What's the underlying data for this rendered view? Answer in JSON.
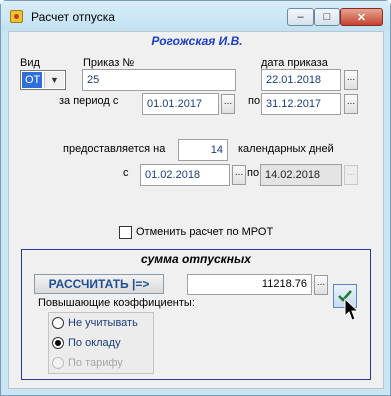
{
  "window": {
    "title": "Расчет отпуска",
    "minimize_glyph": "–",
    "maximize_glyph": "□",
    "close_glyph": "✕"
  },
  "employee_name": "Рогожская И.В.",
  "form": {
    "type_label": "Вид",
    "type_value": "ОТ",
    "order_label": "Приказ №",
    "order_value": "25",
    "order_date_label": "дата приказа",
    "order_date_value": "22.01.2018",
    "period_label": "за период с",
    "period_from": "01.01.2017",
    "period_to_label": "по",
    "period_to": "31.12.2017",
    "granted_label": "предоставляется на",
    "days_value": "14",
    "days_unit_label": "календарных дней",
    "from_label": "с",
    "from_value": "01.02.2018",
    "to_label": "по",
    "to_value": "14.02.2018",
    "mrot_label": "Отменить расчет по МРОТ",
    "mrot_checked": false,
    "dots_label": "..."
  },
  "summary": {
    "title": "сумма отпускных",
    "calc_button": "РАССЧИТАТЬ |=>",
    "amount": "11218.76",
    "coef_label": "Повышающие коэффициенты:",
    "options": [
      {
        "label": "Не учитывать",
        "selected": false,
        "disabled": false
      },
      {
        "label": "По окладу",
        "selected": true,
        "disabled": false
      },
      {
        "label": "По тарифу",
        "selected": false,
        "disabled": true
      }
    ]
  },
  "colors": {
    "accent": "#1c3fbf",
    "group_border": "#2b36a6",
    "title_bar": "#c8e6f4",
    "close_button": "#c5422f"
  }
}
